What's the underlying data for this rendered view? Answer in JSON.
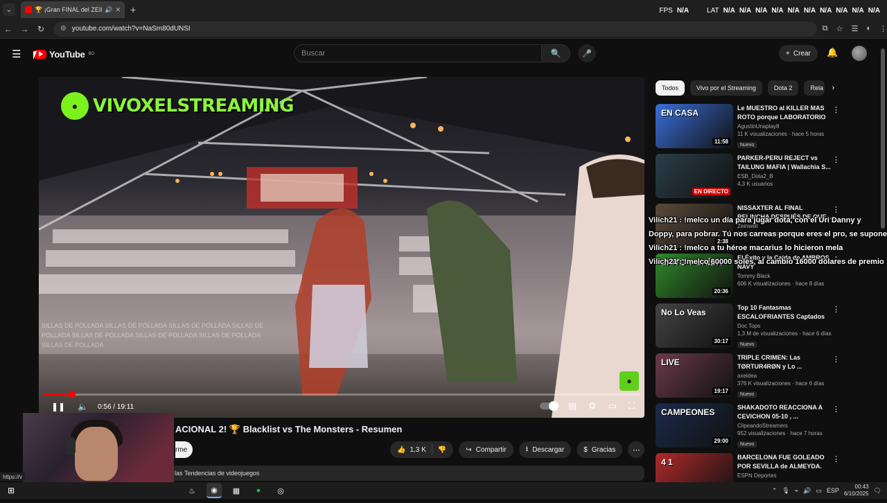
{
  "browser": {
    "tab": {
      "title": "🏆 ¡Gran FINAL del ZEIN..."
    },
    "url": "youtube.com/watch?v=NaSm80dUNSI",
    "status_url": "https://v",
    "overlay_stats": {
      "fps_label": "FPS",
      "fps_value": "N/A",
      "lat_label": "LAT",
      "lat_values": [
        "N/A",
        "N/A",
        "N/A",
        "N/A",
        "N/A",
        "N/A",
        "N/A",
        "N/A",
        "N/A",
        "N/A"
      ]
    }
  },
  "youtube": {
    "logo_text": "YouTube",
    "logo_region": "BO",
    "search_placeholder": "Buscar",
    "create_label": "Crear"
  },
  "player": {
    "watermark": "VIVOXELSTREAMING",
    "time": "0:56 / 19:11",
    "progress": 0.049,
    "ghost_chat": "SILLAS DE POLLADA SILLAS DE POLLADA SILLAS DE POLLADA SILLAS DE POLLADA SILLAS DE POLLADA SILLAS DE POLLADA SILLAS DE POLLADA SILLAS DE POLLADA"
  },
  "video": {
    "title": "ACIONAL 2! 🏆 Blacklist vs The Monsters - Resumen",
    "subscribe_fragment": "rme",
    "likes": "1,3 K",
    "share_label": "Compartir",
    "download_label": "Descargar",
    "thanks_label": "Gracias",
    "description_snippet": "las Tendencias de videojuegos"
  },
  "chips": [
    "Todos",
    "Vivo por el Streaming",
    "Dota 2",
    "Rela"
  ],
  "recommendations": [
    {
      "title": "Le MUESTRO al KILLER MAS ROTO porque LABORATORIO e...",
      "channel": "AgustinUnaplay8",
      "views": "11 K visualizaciones · hace 5 horas",
      "badge": "Nuevo",
      "duration": "11:58",
      "thumb_text": "EN CASA",
      "thumb_color": "#3a6fd8"
    },
    {
      "title": "PARKER-PERU REJECT vs TAILUNG MAFIA | Wallachia S...",
      "channel": "ESB_Dota2_B",
      "views": "4,3 K usuarios",
      "badge": "",
      "duration": "EN DIRECTO",
      "thumb_text": "",
      "thumb_color": "#2a3f4a"
    },
    {
      "title": "NISSAXTER AL FINAL RELINCHA DESPUÉS DE QUE...",
      "channel": "Zeinwell",
      "views": "21 K visualizaciones · hace 6 horas",
      "badge": "",
      "duration": "2:38",
      "thumb_text": "",
      "thumb_color": "#5a4a3a"
    },
    {
      "title": "El Éxito y la Caída de AMBROS NAVY",
      "channel": "Tommy Black",
      "views": "606 K visualizaciones · hace 8 días",
      "badge": "",
      "duration": "20:36",
      "thumb_text": "ÉXITO Y CAÍDA",
      "thumb_color": "#2f8a2a"
    },
    {
      "title": "Top 10 Fantasmas ESCALOFRIANTES Captados E...",
      "channel": "Doc Tops",
      "views": "1,3 M de visualizaciones · hace 6 días",
      "badge": "Nuevo",
      "duration": "30:17",
      "thumb_text": "No Lo Veas",
      "thumb_color": "#444444"
    },
    {
      "title": "TRIPLE CRIMEN: Las TØRTUR4RØN y Lo ...",
      "channel": "axeldea",
      "views": "376 K visualizaciones · hace 6 días",
      "badge": "Nuevo",
      "duration": "19:17",
      "thumb_text": "LIVE",
      "thumb_color": "#6a3a4a"
    },
    {
      "title": "SHAKADOTO REACCIONA A CEVICHON 05-10 , ...",
      "channel": "ClipeandoStreamers",
      "views": "952 visualizaciones · hace 7 horas",
      "badge": "Nuevo",
      "duration": "29:00",
      "thumb_text": "CAMPEONES",
      "thumb_color": "#1a2a4a"
    },
    {
      "title": "BARCELONA FUE GOLEADO POR SEVILLA de ALMEYDA. REAL ...",
      "channel": "ESPN Deportes",
      "views": "",
      "badge": "",
      "duration": "",
      "thumb_text": "4 1",
      "thumb_color": "#b02a2a"
    }
  ],
  "chat_overlay": [
    "Vilich21 : !melco un día para jugar dota, con el Uri Danny y Doppy, para pobrar. Tú nos carreas porque eres el pro, se supone",
    "Vilich21 : !melco a tu héroe macarius lo hicieron mela",
    "Vilich21 : !melco 60000 soles, al cambio 16000 dólares de premio"
  ],
  "taskbar": {
    "language": "ESP",
    "time": "00:43",
    "date": "6/10/2025"
  }
}
